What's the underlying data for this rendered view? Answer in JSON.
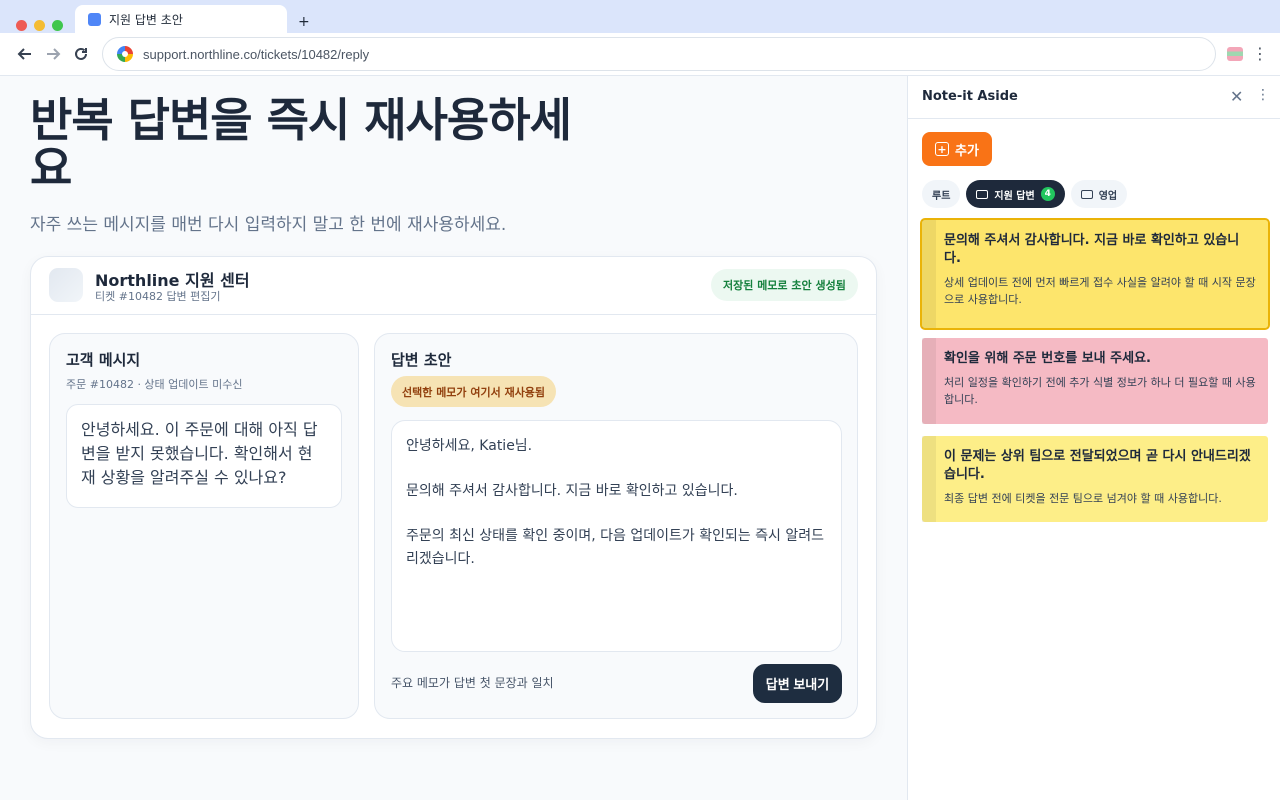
{
  "browser": {
    "tab_title": "지원 답변 초안",
    "new_tab": "+",
    "url": "support.northline.co/tickets/10482/reply"
  },
  "page": {
    "hero_title": "반복 답변을 즉시 재사용하세요",
    "subtitle": "자주 쓰는 메시지를 매번 다시 입력하지 말고 한 번에 재사용하세요."
  },
  "card": {
    "org_name": "Northline 지원 센터",
    "org_sub": "티켓 #10482 답변 편집기",
    "saved_badge": "저장된 메모로 초안 생성됨"
  },
  "customer": {
    "title": "고객 메시지",
    "sub": "주문 #10482 · 상태 업데이트 미수신",
    "message": "안녕하세요. 이 주문에 대해 아직 답변을 받지 못했습니다. 확인해서 현재 상황을 알려주실 수 있나요?"
  },
  "draft": {
    "title": "답변 초안",
    "reuse_badge": "선택한 메모가 여기서 재사용됨",
    "line1": "안녕하세요, Katie님.",
    "line2": "문의해 주셔서 감사합니다. 지금 바로 확인하고 있습니다.",
    "line3": "주문의 최신 상태를 확인 중이며, 다음 업데이트가 확인되는 즉시 알려드리겠습니다.",
    "note": "주요 메모가 답변 첫 문장과 일치",
    "send_label": "답변 보내기"
  },
  "side_panel": {
    "title": "Note-it Aside",
    "add_label": "추가",
    "chips": [
      {
        "label": "루트"
      },
      {
        "label": "지원 답변",
        "count": "4"
      },
      {
        "label": "영업"
      }
    ],
    "notes": [
      {
        "title": "문의해 주셔서 감사합니다. 지금 바로 확인하고 있습니다.",
        "body": "상세 업데이트 전에 먼저 빠르게 접수 사실을 알려야 할 때 시작 문장으로 사용합니다.",
        "color": "#fde56c"
      },
      {
        "title": "확인을 위해 주문 번호를 보내 주세요.",
        "body": "처리 일정을 확인하기 전에 추가 식별 정보가 하나 더 필요할 때 사용합니다.",
        "color": "#f5bac4"
      },
      {
        "title": "이 문제는 상위 팀으로 전달되었으며 곧 다시 안내드리겠습니다.",
        "body": "최종 답변 전에 티켓을 전문 팀으로 넘겨야 할 때 사용합니다.",
        "color": "#fdee88"
      }
    ]
  }
}
